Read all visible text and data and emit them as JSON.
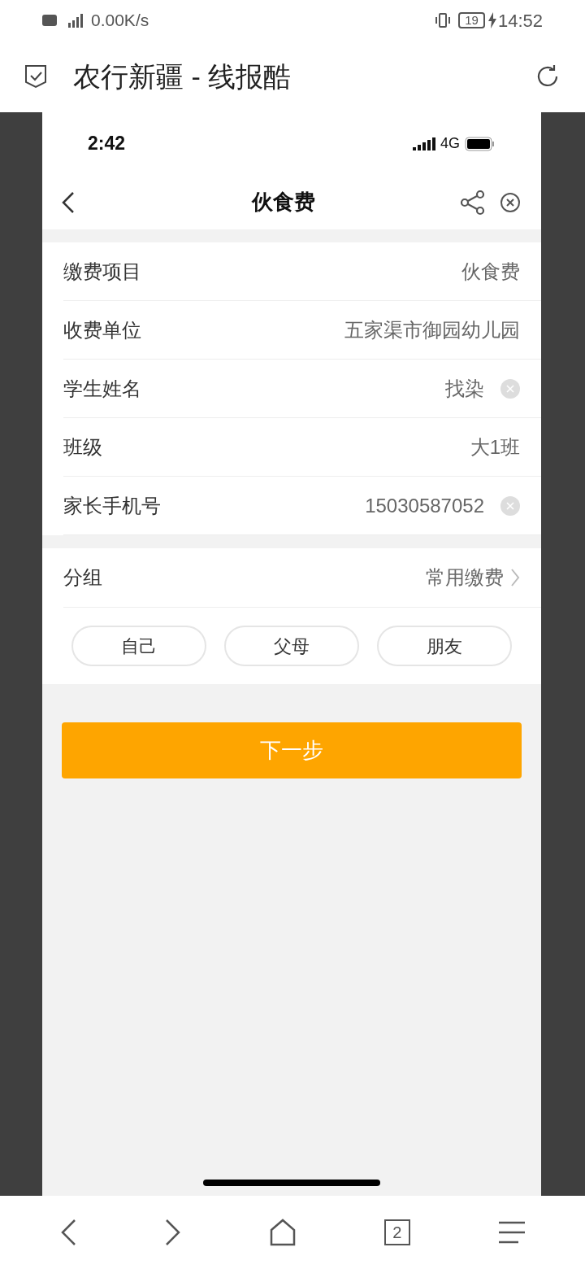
{
  "status_bar": {
    "network_speed": "0.00K/s",
    "battery": "19",
    "time": "14:52"
  },
  "browser": {
    "title": "农行新疆 - 线报酷"
  },
  "inner_status_bar": {
    "time": "2:42",
    "network": "4G"
  },
  "nav": {
    "title": "伙食费"
  },
  "fields": [
    {
      "label": "缴费项目",
      "value": "伙食费",
      "clearable": false
    },
    {
      "label": "收费单位",
      "value": "五家渠市御园幼儿园",
      "clearable": false
    },
    {
      "label": "学生姓名",
      "value": "找染",
      "clearable": true
    },
    {
      "label": "班级",
      "value": "大1班",
      "clearable": false
    },
    {
      "label": "家长手机号",
      "value": "15030587052",
      "clearable": true
    }
  ],
  "group": {
    "label": "分组",
    "value": "常用缴费"
  },
  "group_options": [
    {
      "label": "自己",
      "selected": false
    },
    {
      "label": "父母",
      "selected": false
    },
    {
      "label": "朋友",
      "selected": false
    }
  ],
  "next_button": "下一步",
  "bottom_nav": {
    "tab_count": "2"
  }
}
